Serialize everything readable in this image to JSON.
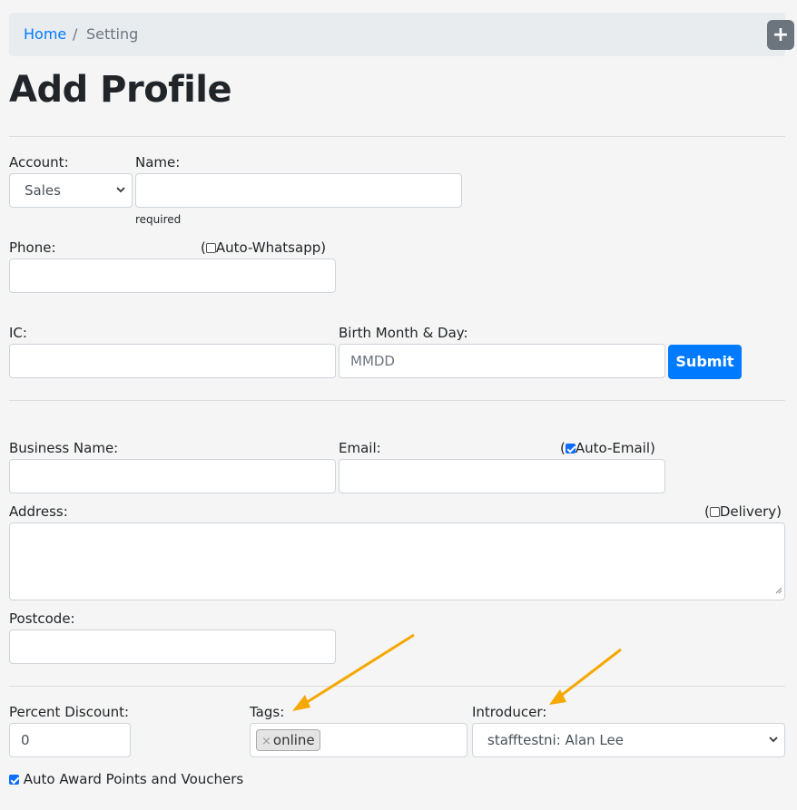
{
  "breadcrumb": {
    "home": "Home",
    "separator": "/",
    "current": "Setting"
  },
  "add_button": {
    "icon": "plus-icon",
    "glyph": "+"
  },
  "title": "Add Profile",
  "account": {
    "label": "Account:",
    "selected": "Sales"
  },
  "name": {
    "label": "Name:",
    "value": "",
    "hint": "required"
  },
  "phone": {
    "label": "Phone:",
    "value": "",
    "auto_whatsapp_open": "(",
    "auto_whatsapp_label": "Auto-Whatsapp)",
    "auto_whatsapp_checked": false
  },
  "ic": {
    "label": "IC:",
    "value": ""
  },
  "birth": {
    "label": "Birth Month & Day:",
    "placeholder": "MMDD"
  },
  "submit_label": "Submit",
  "business": {
    "label": "Business Name:",
    "value": ""
  },
  "email": {
    "label": "Email:",
    "value": "",
    "auto_email_open": "(",
    "auto_email_label": "Auto-Email)",
    "auto_email_checked": true
  },
  "address": {
    "label": "Address:",
    "value": "",
    "delivery_open": "(",
    "delivery_label": "Delivery)",
    "delivery_checked": false
  },
  "postcode": {
    "label": "Postcode:",
    "value": ""
  },
  "discount": {
    "label": "Percent Discount:",
    "value": "0"
  },
  "tags": {
    "label": "Tags:",
    "items": [
      "online"
    ],
    "remove_glyph": "×"
  },
  "introducer": {
    "label": "Introducer:",
    "selected": "stafftestni: Alan Lee"
  },
  "auto_award": {
    "label": "Auto Award Points and Vouchers",
    "checked": true
  },
  "colors": {
    "link": "#007bff",
    "primary": "#007bff",
    "annotation_arrow": "#f5a800",
    "background": "#f5f5f5"
  }
}
